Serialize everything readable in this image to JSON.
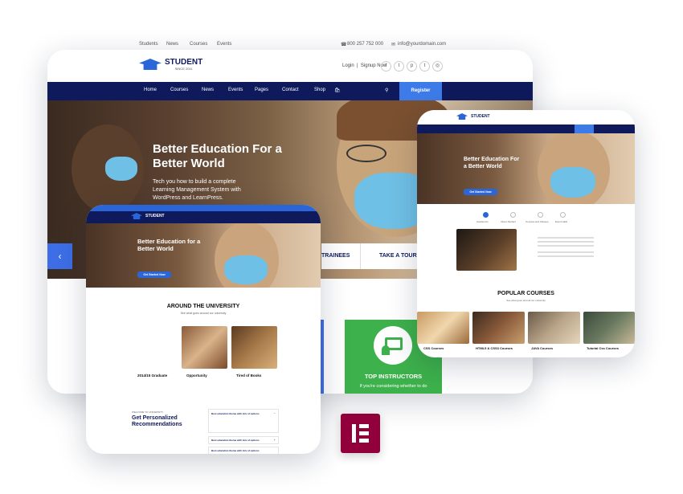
{
  "topbar": {
    "links": [
      "Students",
      "News",
      "Courses",
      "Events"
    ],
    "phone": "800 257 752 000",
    "email": "info@yourdomain.com"
  },
  "main": {
    "logo": {
      "name": "STUDENT",
      "since": "SINCE 2011"
    },
    "auth": "Login  |  Signup Now",
    "social": [
      "f",
      "t",
      "p",
      "t",
      "◎"
    ],
    "nav": [
      "Home",
      "Courses",
      "News",
      "Events",
      "Pages",
      "Contact",
      "Shop"
    ],
    "register": "Register",
    "hero": {
      "title": "Better Education For a Better World",
      "text": "Tech you how to build a complete Learning Management System with WordPress and LearnPress."
    },
    "ribbon": [
      "TRAINEES",
      "TAKE A TOUR"
    ],
    "instructors": "TOP INSTRUCTORS",
    "instructors_text": "If you're considering whether to do"
  },
  "tablet": {
    "hero_title": "Better Education for a Better World",
    "hero_btn": "Get Started Now",
    "section": "AROUND THE UNIVERSITY",
    "section_sub": "See what goes around our university",
    "cards": [
      "2014/15 Graduate",
      "Opportunity",
      "Tired of Books"
    ],
    "kicker": "WELCOME TO UNIVERSITY",
    "rec_title": "Get Personalized Recommendations",
    "faq": [
      "Best education theme with lots of options",
      "Best education theme with lots of options",
      "Best education theme with lots of options"
    ]
  },
  "right": {
    "hero_title": "Better Education For a Better World",
    "hero_btn": "Get Started Now",
    "tabs": [
      "Academics",
      "About Student",
      "Courses and Classes",
      "Event Halls"
    ],
    "section": "POPULAR COURSES",
    "section_sub": "See what goes around our university",
    "courses": [
      "CSS Courses",
      "HTML5 & CSS3 Courses",
      "JAVA Courses",
      "Tutorial Css Courses"
    ]
  },
  "colors": {
    "navy": "#0f1a5c",
    "blue": "#2b66d9",
    "green": "#3db14b",
    "elementor": "#92003b"
  }
}
